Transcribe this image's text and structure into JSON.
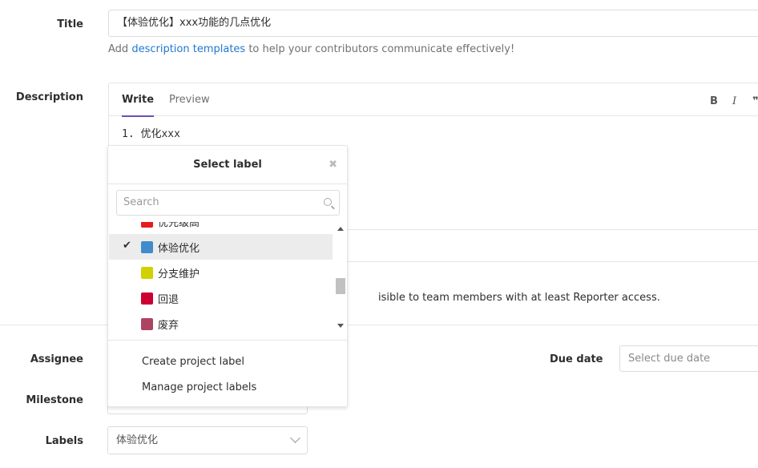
{
  "form": {
    "title_label": "Title",
    "title_value": "【体验优化】xxx功能的几点优化",
    "hint_prefix": "Add",
    "hint_link": "description templates",
    "hint_suffix": "to help your contributors communicate effectively!",
    "description_label": "Description",
    "tab_write": "Write",
    "tab_preview": "Preview",
    "tool_bold": "B",
    "tool_italic": "I",
    "tool_quote": "❞",
    "description_text": "1. 优化xxx",
    "confidential_text": "isible to team members with at least Reporter access.",
    "assignee_label": "Assignee",
    "milestone_label": "Milestone",
    "labels_label": "Labels",
    "labels_value": "体验优化",
    "due_date_label": "Due date",
    "due_date_placeholder": "Select due date"
  },
  "dropdown": {
    "title": "Select label",
    "close_icon": "✖",
    "search_placeholder": "Search",
    "check_icon": "✔",
    "items": [
      {
        "name": "优先级高",
        "color": "#e81c1c",
        "selected": false
      },
      {
        "name": "体验优化",
        "color": "#428bca",
        "selected": true
      },
      {
        "name": "分支维护",
        "color": "#d1d100",
        "selected": false
      },
      {
        "name": "回退",
        "color": "#cc0033",
        "selected": false
      },
      {
        "name": "废弃",
        "color": "#ad4363",
        "selected": false
      }
    ],
    "create_label": "Create project label",
    "manage_label": "Manage project labels"
  }
}
